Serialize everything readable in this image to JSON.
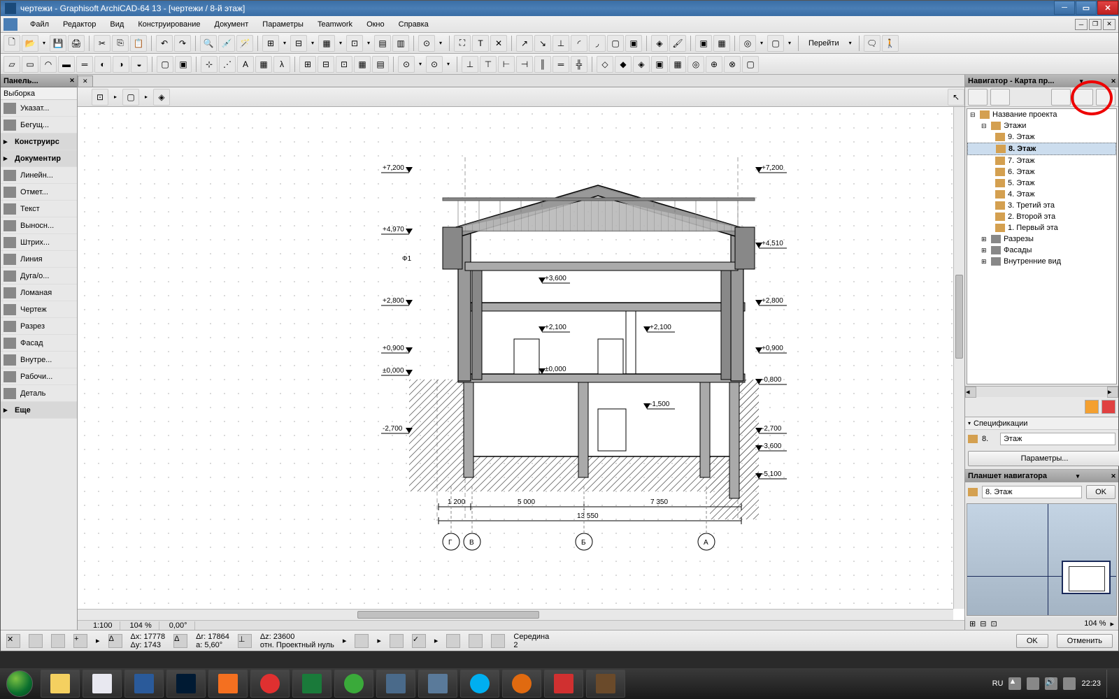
{
  "title": "чертежи - Graphisoft ArchiCAD-64 13 - [чертежи / 8-й этаж]",
  "menu": [
    "Файл",
    "Редактор",
    "Вид",
    "Конструирование",
    "Документ",
    "Параметры",
    "Teamwork",
    "Окно",
    "Справка"
  ],
  "toolbar_goto": "Перейти",
  "left_panel": {
    "title": "Панель...",
    "selection": "Выборка",
    "tools": [
      {
        "label": "Указат...",
        "is_group": false
      },
      {
        "label": "Бегущ...",
        "is_group": false
      },
      {
        "label": "Конструирс",
        "is_group": true
      },
      {
        "label": "Документир",
        "is_group": true
      },
      {
        "label": "Линейн...",
        "is_group": false
      },
      {
        "label": "Отмет...",
        "is_group": false
      },
      {
        "label": "Текст",
        "is_group": false
      },
      {
        "label": "Выносн...",
        "is_group": false
      },
      {
        "label": "Штрих...",
        "is_group": false
      },
      {
        "label": "Линия",
        "is_group": false
      },
      {
        "label": "Дуга/о...",
        "is_group": false
      },
      {
        "label": "Ломаная",
        "is_group": false
      },
      {
        "label": "Чертеж",
        "is_group": false
      },
      {
        "label": "Разрез",
        "is_group": false
      },
      {
        "label": "Фасад",
        "is_group": false
      },
      {
        "label": "Внутре...",
        "is_group": false
      },
      {
        "label": "Рабочи...",
        "is_group": false
      },
      {
        "label": "Деталь",
        "is_group": false
      },
      {
        "label": "Еще",
        "is_group": true
      }
    ]
  },
  "drawing": {
    "elev_left": [
      "+7,200",
      "+4,970",
      "+2,800",
      "+0,900",
      "±0,000",
      "-2,700"
    ],
    "elev_right": [
      "+7,200",
      "+4,510",
      "+2,800",
      "+0,900",
      "-0,800",
      "-2,700",
      "-3,600",
      "-5,100"
    ],
    "interior": [
      "+3,600",
      "+2,100",
      "+2,100",
      "±0,000",
      "-1,500"
    ],
    "grid_label": "Ф1",
    "dim_bottom": [
      "1 200",
      "5 000",
      "7 350"
    ],
    "dim_total": "13 550",
    "axis_labels": [
      "Г",
      "В",
      "Б",
      "А"
    ]
  },
  "navigator": {
    "title": "Навигатор - Карта пр...",
    "root": "Название проекта",
    "floors_label": "Этажи",
    "floors": [
      "9. Этаж",
      "8. Этаж",
      "7. Этаж",
      "6. Этаж",
      "5. Этаж",
      "4. Этаж",
      "3. Третий эта",
      "2. Второй эта",
      "1. Первый эта"
    ],
    "selected_floor": "8. Этаж",
    "sections": [
      "Разрезы",
      "Фасады",
      "Внутренние вид"
    ]
  },
  "spec": {
    "title": "Спецификации",
    "num": "8.",
    "type": "Этаж",
    "params_btn": "Параметры..."
  },
  "preview": {
    "title": "Планшет навигатора",
    "input": "8. Этаж",
    "ok": "OK",
    "zoom": "104 %"
  },
  "status": {
    "dx": "Δx: 17778",
    "dy": "Δy: 1743",
    "dr": "Δr: 17864",
    "da": "a: 5,60°",
    "dz": "Δz: 23600",
    "origin": "отн. Проектный нуль",
    "mid": "Середина",
    "mid_n": "2",
    "ok": "OK",
    "cancel": "Отменить"
  },
  "taskbar": {
    "lang": "RU",
    "time": "22:23"
  },
  "bottom_strip": {
    "scale": "1:100",
    "zoom": "104 %",
    "angle": "0,00°"
  }
}
